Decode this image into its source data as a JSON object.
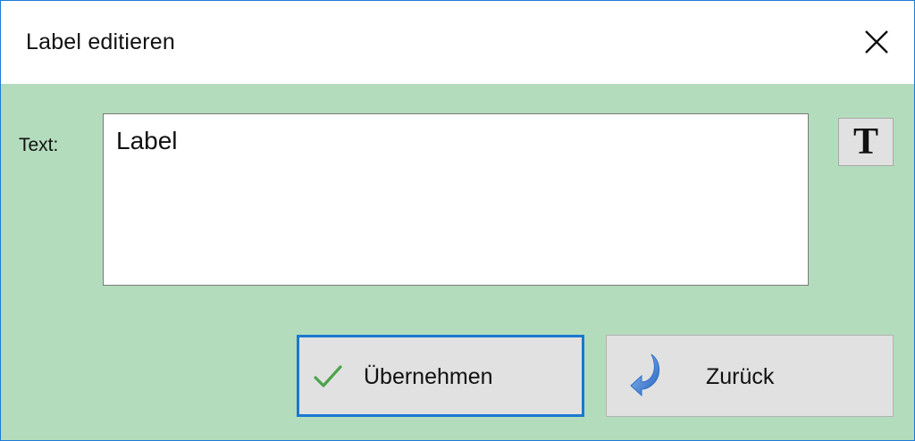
{
  "window": {
    "title": "Label editieren"
  },
  "form": {
    "text_label": "Text:",
    "text_value": "Label",
    "font_button_glyph": "T"
  },
  "buttons": {
    "apply_label": "Übernehmen",
    "back_label": "Zurück"
  },
  "icons": {
    "close": "close-icon",
    "font": "font-icon",
    "apply": "checkmark-icon",
    "back": "undo-arrow-icon"
  },
  "colors": {
    "window_border": "#1f7ad6",
    "body_background": "#b3dcbc",
    "titlebar_background": "#ffffff",
    "button_background": "#e1e1e1",
    "focus_border": "#1b78d0",
    "checkmark": "#4aa34a",
    "undo_arrow": "#2d6fc7"
  }
}
